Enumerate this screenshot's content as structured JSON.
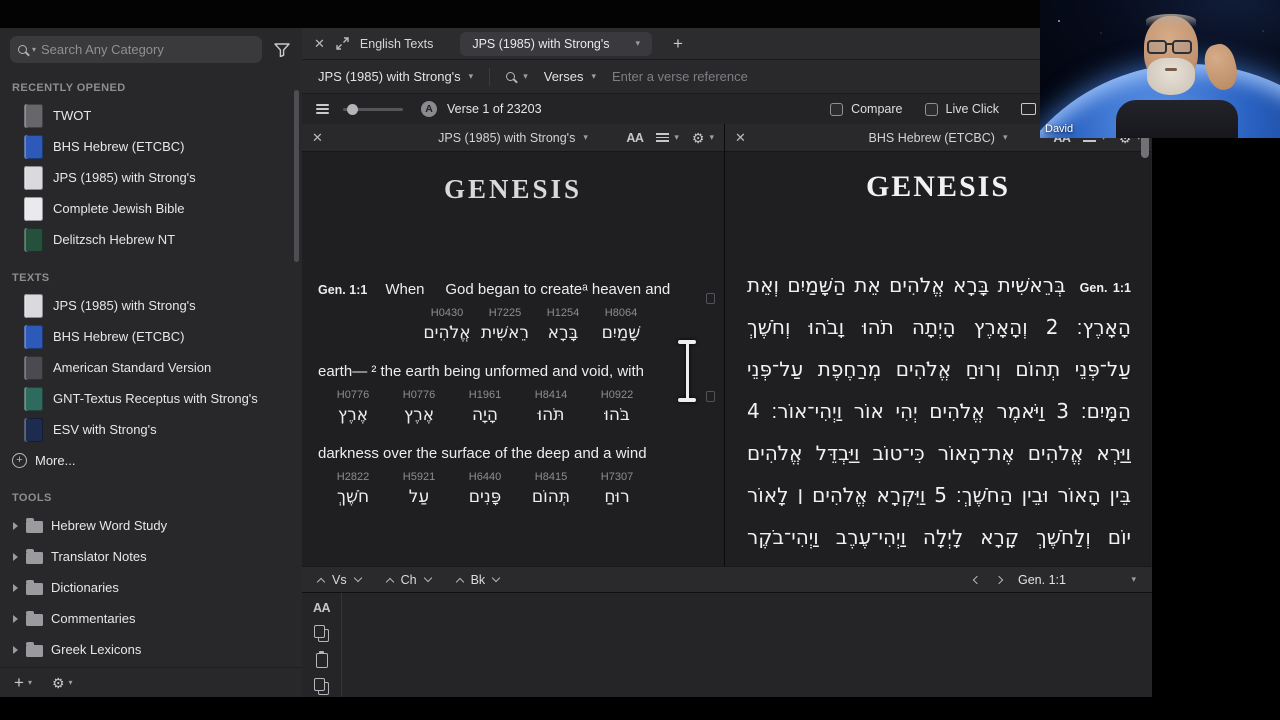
{
  "colors": {
    "sidebar_bg": "#28282a",
    "panel_bg": "#1f1f22",
    "earth_blue": "#2a62c2"
  },
  "icons": {
    "font_size": "AA",
    "gear": "⚙",
    "close": "✕",
    "add": "+",
    "plus_small": "+",
    "chevron_down": "▾"
  },
  "sidebar": {
    "search_placeholder": "Search Any Category",
    "sections": [
      {
        "title": "RECENTLY OPENED",
        "items": [
          {
            "label": "TWOT",
            "color": "#66666b"
          },
          {
            "label": "BHS Hebrew (ETCBC)",
            "color": "#2d59b8"
          },
          {
            "label": "JPS (1985) with Strong's",
            "color": "#d9d9de"
          },
          {
            "label": "Complete Jewish Bible",
            "color": "#e9e9ee"
          },
          {
            "label": "Delitzsch Hebrew NT",
            "color": "#24503c"
          }
        ]
      },
      {
        "title": "TEXTS",
        "items": [
          {
            "label": "JPS (1985) with Strong's",
            "color": "#d9d9de"
          },
          {
            "label": "BHS Hebrew (ETCBC)",
            "color": "#2d59b8"
          },
          {
            "label": "American Standard Version",
            "color": "#4a4a50"
          },
          {
            "label": "GNT-Textus Receptus with Strong's",
            "color": "#2e6b5e"
          },
          {
            "label": "ESV with Strong's",
            "color": "#1d2b4f"
          }
        ],
        "more_label": "More..."
      },
      {
        "title": "TOOLS",
        "items": [
          {
            "label": "Hebrew Word Study"
          },
          {
            "label": "Translator Notes"
          },
          {
            "label": "Dictionaries"
          },
          {
            "label": "Commentaries"
          },
          {
            "label": "Greek Lexicons"
          }
        ]
      }
    ]
  },
  "tabbar": {
    "group_label": "English Texts",
    "tab_label": "JPS (1985) with Strong's"
  },
  "toolbar": {
    "text_selector": "JPS (1985) with Strong's",
    "scope_selector": "Verses",
    "verse_input_placeholder": "Enter a verse reference"
  },
  "statusbar": {
    "marker": "A",
    "verse_status": "Verse 1 of 23203",
    "compare_label": "Compare",
    "live_click_label": "Live Click"
  },
  "left_panel": {
    "header_title": "JPS (1985) with Strong's",
    "book_title": "GENESIS",
    "blocks": [
      {
        "ref": "Gen. 1:1",
        "english": "When     God began to createᵃ heaven and",
        "words": [
          {
            "strongs": "H0430",
            "hebrew": "אֱלֹהִים"
          },
          {
            "strongs": "H7225",
            "hebrew": "רֵאשִׁית"
          },
          {
            "strongs": "H1254",
            "hebrew": "בָּרָא"
          },
          {
            "strongs": "H8064",
            "hebrew": "שָׁמַיִם"
          }
        ]
      },
      {
        "english": "earth— ² the earth being unformed and void, with",
        "words": [
          {
            "strongs": "H0776",
            "hebrew": "אֶרֶץ"
          },
          {
            "strongs": "H0776",
            "hebrew": "אֶרֶץ"
          },
          {
            "strongs": "H1961",
            "hebrew": "הָיָה"
          },
          {
            "strongs": "H8414",
            "hebrew": "תֹּהוּ"
          },
          {
            "strongs": "H0922",
            "hebrew": "בֹּהוּ"
          }
        ]
      },
      {
        "english": "darkness over the surface of the deep and a wind",
        "words": [
          {
            "strongs": "H2822",
            "hebrew": "חֹשֶׁךְ"
          },
          {
            "strongs": "H5921",
            "hebrew": "עַל"
          },
          {
            "strongs": "H6440",
            "hebrew": "פָּנִים"
          },
          {
            "strongs": "H8415",
            "hebrew": "תְּהוֹם"
          },
          {
            "strongs": "H7307",
            "hebrew": "רוּחַ"
          }
        ]
      }
    ]
  },
  "right_panel": {
    "header_title": "BHS Hebrew (ETCBC)",
    "book_title": "GENESIS",
    "ref": "Gen. 1:1",
    "lines": [
      "בְּרֵאשִׁית בָּרָא אֱלֹהִים אֵת הַשָּׁמַיִם וְאֵת",
      "הָאָרֶץ׃ 2 וְהָאָרֶץ הָיְתָה תֹהוּ וָבֹהוּ וְחֹשֶׁךְ",
      "עַל־פְּנֵי תְהוֹם וְרוּחַ אֱלֹהִים מְרַחֶפֶת עַל־פְּנֵי",
      "הַמָּיִם׃ 3 וַיֹּאמֶר אֱלֹהִים יְהִי אוֹר וַיְהִי־אוֹר׃ 4",
      "וַיַּרְא אֱלֹהִים אֶת־הָאוֹר כִּי־טוֹב וַיַּבְדֵּל אֱלֹהִים",
      "בֵּין הָאוֹר וּבֵין הַחֹשֶׁךְ׃ 5 וַיִּקְרָא אֱלֹהִים ׀ לָאוֹר",
      "יוֹם וְלַחֹשֶׁךְ קָרָא לָיְלָה וַיְהִי־עֶרֶב וַיְהִי־בֹקֶר"
    ]
  },
  "panel_footer": {
    "vs_label": "Vs",
    "ch_label": "Ch",
    "bk_label": "Bk",
    "ref": "Gen. 1:1"
  },
  "video": {
    "name_label": "David"
  }
}
